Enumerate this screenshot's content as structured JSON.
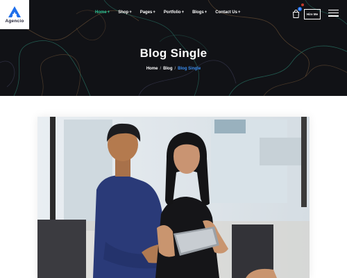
{
  "brand": {
    "name": "Agencio"
  },
  "nav": {
    "items": [
      {
        "label": "Home",
        "active": true
      },
      {
        "label": "Shop",
        "active": false
      },
      {
        "label": "Pages",
        "active": false
      },
      {
        "label": "Portfolio",
        "active": false
      },
      {
        "label": "Blogs",
        "active": false
      },
      {
        "label": "Contact Us",
        "active": false
      }
    ],
    "dropdown_marker": "+"
  },
  "header_actions": {
    "cart_count": "0",
    "hire_label": "Hire Me"
  },
  "hero": {
    "title": "Blog Single",
    "breadcrumb": [
      {
        "label": "Home"
      },
      {
        "label": "Blog"
      },
      {
        "label": "Blog Single"
      }
    ],
    "separator": "/"
  },
  "colors": {
    "hero_background": "#111216",
    "accent_green": "#2ecc9b",
    "accent_blue": "#3b8ef0",
    "logo_blue": "#1f6feb"
  },
  "icons": [
    "agencio-logo-icon",
    "shopping-bag-icon",
    "hamburger-menu-icon"
  ]
}
